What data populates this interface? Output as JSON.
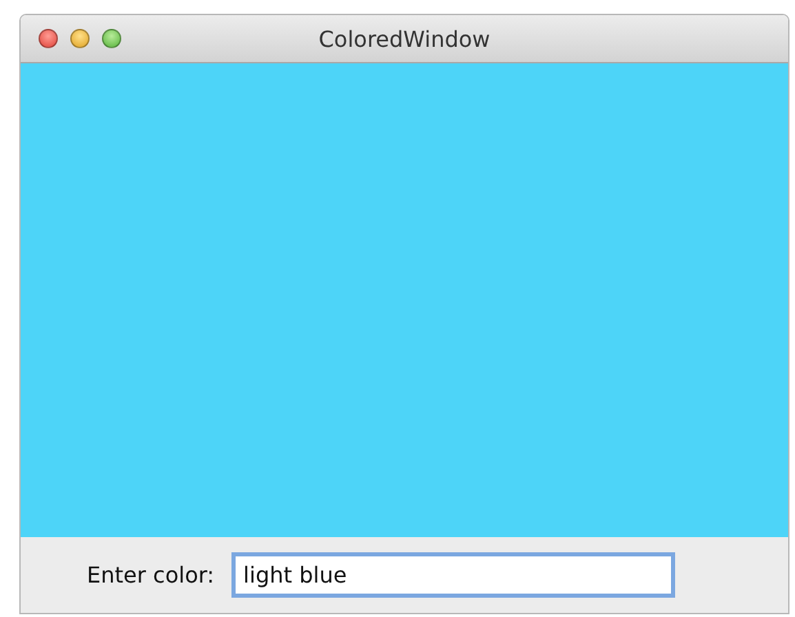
{
  "window": {
    "title": "ColoredWindow"
  },
  "panel": {
    "color": "#4dd4f8"
  },
  "form": {
    "label": "Enter color:",
    "value": "light blue",
    "focused": true
  }
}
